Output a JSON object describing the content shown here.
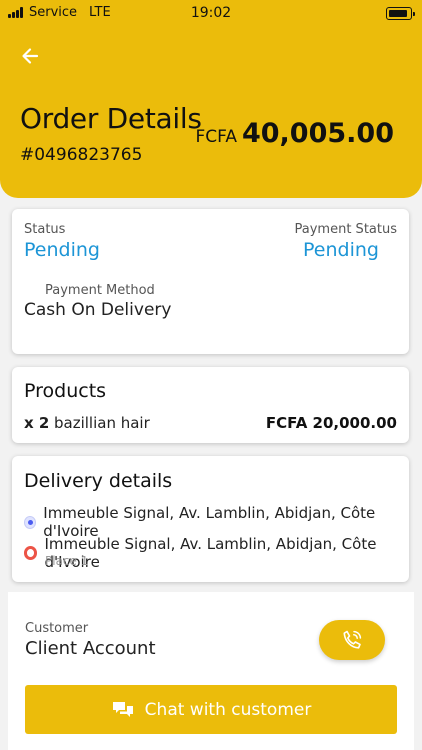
{
  "status_bar": {
    "carrier": "Service",
    "network": "LTE",
    "time": "19:02"
  },
  "header": {
    "title": "Order Details",
    "order_number": "#0496823765",
    "currency": "FCFA",
    "total": "40,005.00",
    "accent_color": "#ebbc0b"
  },
  "order_status": {
    "status_label": "Status",
    "status_value": "Pending",
    "payment_status_label": "Payment Status",
    "payment_status_value": "Pending",
    "payment_method_label": "Payment Method",
    "payment_method_value": "Cash On Delivery",
    "value_color": "#1d95d6"
  },
  "products": {
    "heading": "Products",
    "items": [
      {
        "qty": "x 2",
        "name": "bazillian hair",
        "price": "FCFA 20,000.00"
      }
    ]
  },
  "delivery": {
    "heading": "Delivery details",
    "pickup_address": "Immeuble Signal, Av. Lamblin, Abidjan, Côte d'Ivoire",
    "dropoff_address": "Immeuble Signal, Av. Lamblin, Abidjan, Côte d'Ivoire",
    "dropoff_place": "Place 1"
  },
  "customer": {
    "label": "Customer",
    "name": "Client Account",
    "call_icon": "phone-call-icon",
    "chat_label": "Chat with customer",
    "chat_icon": "chat-bubbles-icon"
  }
}
